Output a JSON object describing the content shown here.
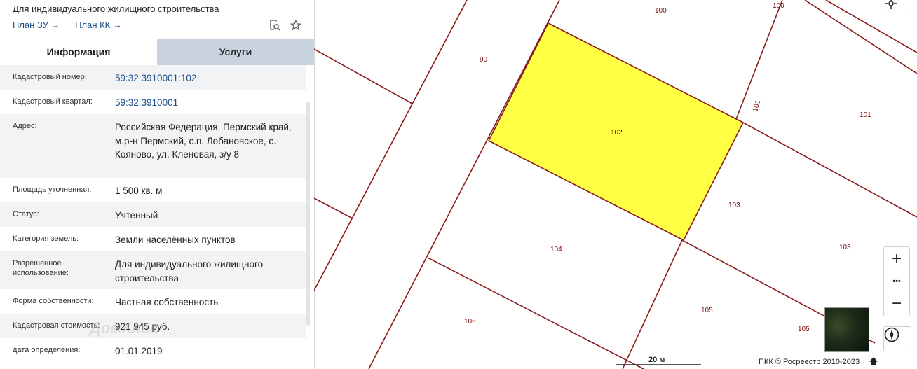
{
  "panel": {
    "subtitle": "Для индивидуального жилищного строительства",
    "links": [
      "План ЗУ →",
      "План КК →"
    ],
    "tabs": [
      "Информация",
      "Услуги"
    ],
    "rows": [
      {
        "label": "Кадастровый номер:",
        "value": "59:32:3910001:102"
      },
      {
        "label": "Кадастровый квартал:",
        "value": "59:32:3910001"
      },
      {
        "label": "Адрес:",
        "value": "Российская Федерация, Пермский край, м.р-н Пермский, с.п. Лобановское, с. Кояново, ул. Кленовая, з/у 8"
      },
      {
        "label": "Площадь уточненная:",
        "value": "1 500 кв. м"
      },
      {
        "label": "Статус:",
        "value": "Учтенный"
      },
      {
        "label": "Категория земель:",
        "value": "Земли населённых пунктов"
      },
      {
        "label": "Разрешенное использование:",
        "value": "Для индивидуального жилищного строительства"
      },
      {
        "label": "Форма собственности:",
        "value": "Частная собственность"
      },
      {
        "label": "Кадастровая стоимость:",
        "value": "921 945 руб."
      },
      {
        "label": "дата определения:",
        "value": "01.01.2019"
      }
    ],
    "watermark": "ДомКлик"
  },
  "map": {
    "parcels": [
      "100",
      "100",
      "90",
      "101",
      "101",
      "102",
      "103",
      "103",
      "104",
      "105",
      "105",
      "106"
    ],
    "scale": "20 м",
    "attribution": "ПКК © Росреестр 2010-2023",
    "zoom_in": "+",
    "zoom_out": "−",
    "more": "•••",
    "colors": {
      "selected": "#ffff44",
      "boundary": "#8b1a1a"
    }
  }
}
